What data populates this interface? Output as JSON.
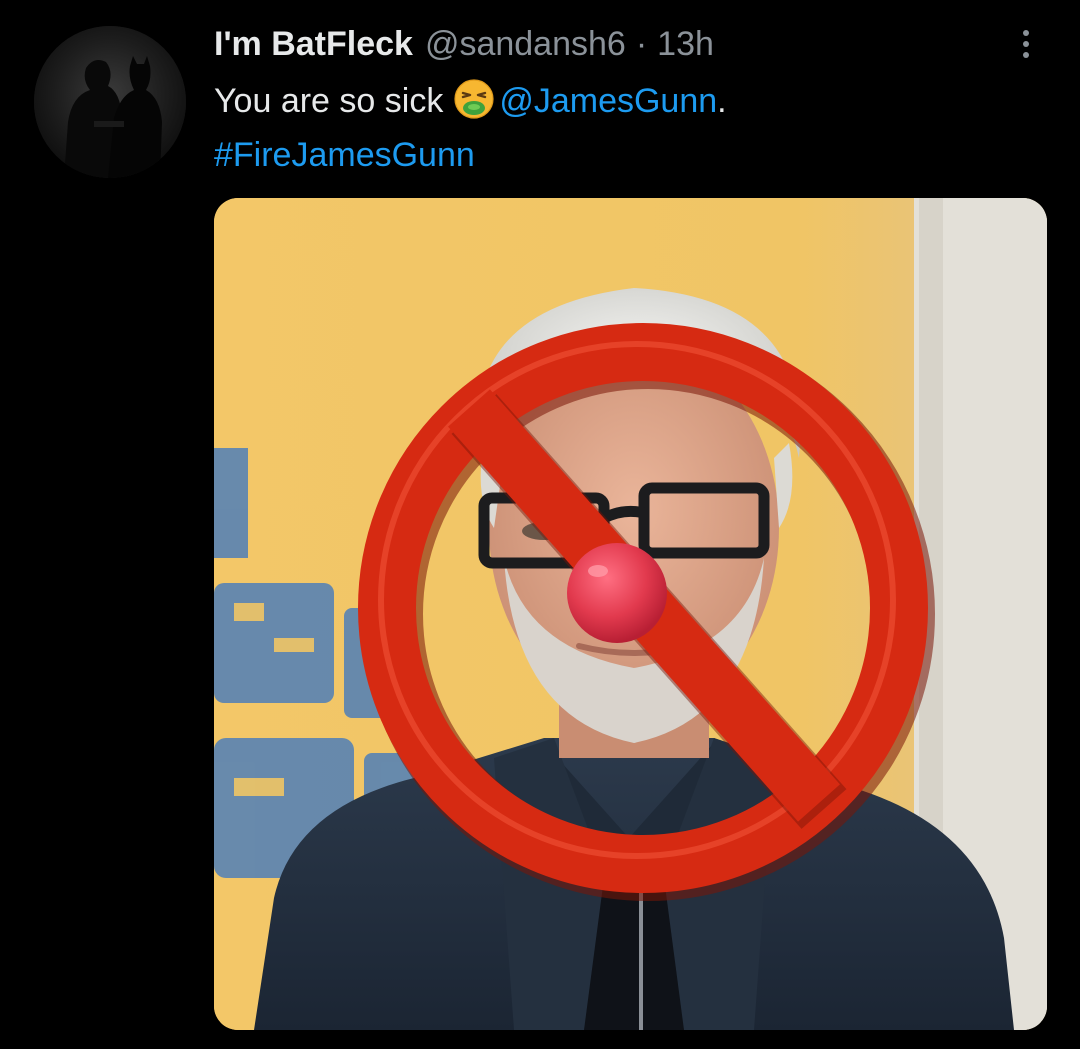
{
  "tweet": {
    "author": {
      "display_name": "I'm BatFleck",
      "handle": "@sandansh6"
    },
    "separator": "·",
    "timestamp": "13h",
    "text": {
      "prefix": "You are so sick",
      "emoji": "nauseated-face-emoji",
      "mention": "@JamesGunn",
      "suffix": ".",
      "hashtag": "#FireJamesGunn"
    },
    "more_icon": "more-vertical-icon",
    "media": {
      "type": "photo",
      "overlay_icons": [
        "prohibited-sign-icon",
        "clown-nose-icon"
      ]
    }
  },
  "colors": {
    "background": "#000000",
    "text": "#e7e9ea",
    "secondary": "#8b9299",
    "link": "#1d9bf0",
    "prohibition_red": "#d62a12",
    "nose_red": "#e23a4e"
  }
}
